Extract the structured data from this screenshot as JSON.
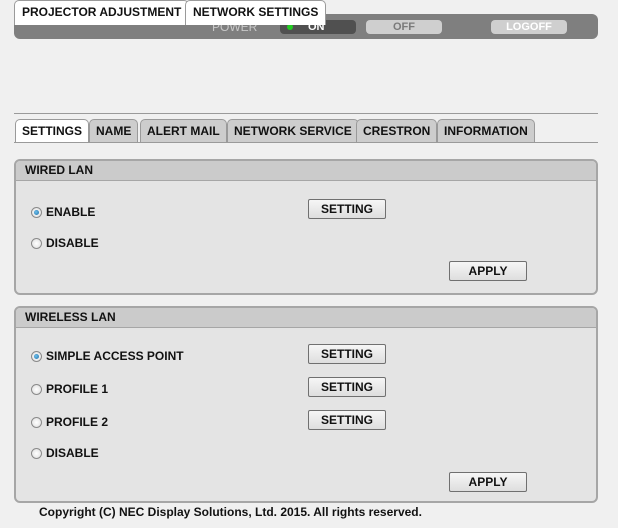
{
  "topbar": {
    "power_label": "POWER",
    "on_label": "ON",
    "off_label": "OFF",
    "logoff_label": "LOGOFF",
    "power_state": "on",
    "indicator_color": "#22cc22"
  },
  "main_tabs": [
    {
      "label": "PROJECTOR ADJUSTMENT",
      "active": false
    },
    {
      "label": "NETWORK SETTINGS",
      "active": true
    }
  ],
  "sub_tabs": [
    {
      "label": "SETTINGS",
      "active": true
    },
    {
      "label": "NAME",
      "active": false
    },
    {
      "label": "ALERT MAIL",
      "active": false
    },
    {
      "label": "NETWORK SERVICE",
      "active": false
    },
    {
      "label": "CRESTRON",
      "active": false
    },
    {
      "label": "INFORMATION",
      "active": false
    }
  ],
  "wired_lan": {
    "title": "WIRED LAN",
    "options": [
      {
        "label": "ENABLE",
        "checked": true,
        "setting_label": "SETTING"
      },
      {
        "label": "DISABLE",
        "checked": false
      }
    ],
    "apply_label": "APPLY"
  },
  "wireless_lan": {
    "title": "WIRELESS LAN",
    "options": [
      {
        "label": "SIMPLE ACCESS POINT",
        "checked": true,
        "setting_label": "SETTING"
      },
      {
        "label": "PROFILE 1",
        "checked": false,
        "setting_label": "SETTING"
      },
      {
        "label": "PROFILE 2",
        "checked": false,
        "setting_label": "SETTING"
      },
      {
        "label": "DISABLE",
        "checked": false
      }
    ],
    "apply_label": "APPLY"
  },
  "footer": {
    "copyright": "Copyright (C) NEC Display Solutions, Ltd. 2015. All rights reserved."
  }
}
